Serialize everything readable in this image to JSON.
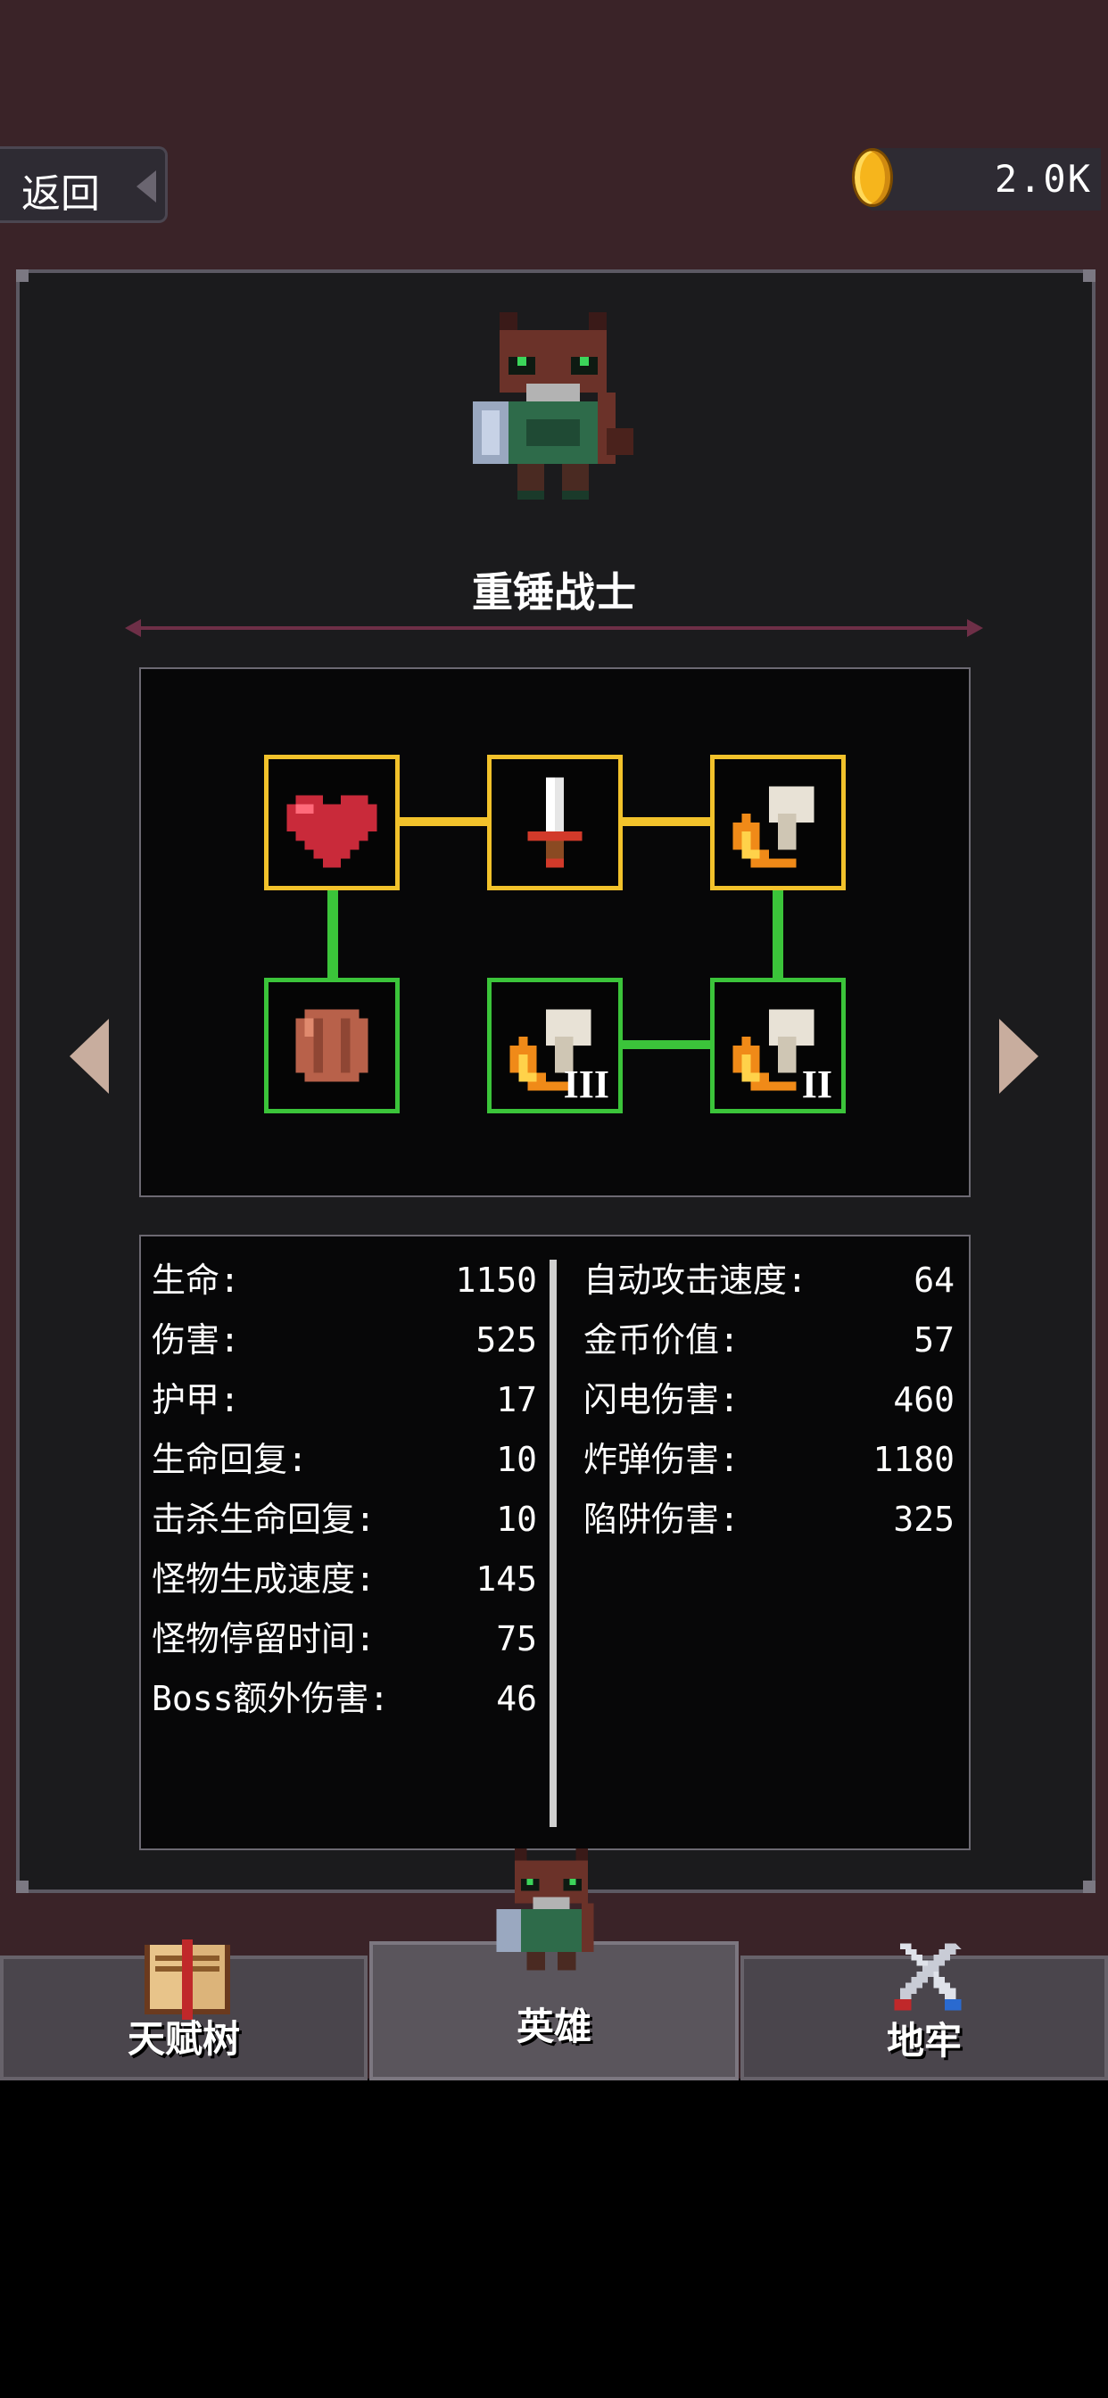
{
  "header": {
    "back_label": "返回",
    "coins": "2.0K"
  },
  "hero": {
    "name": "重锤战士"
  },
  "talent_tree": {
    "nodes": [
      {
        "icon": "heart-icon",
        "state": "gold",
        "level": ""
      },
      {
        "icon": "sword-icon",
        "state": "gold",
        "level": ""
      },
      {
        "icon": "fire-hammer-icon",
        "state": "gold",
        "level": ""
      },
      {
        "icon": "wooden-shield-icon",
        "state": "green",
        "level": ""
      },
      {
        "icon": "fire-hammer-icon",
        "state": "green",
        "level": "III"
      },
      {
        "icon": "fire-hammer-icon",
        "state": "green",
        "level": "II"
      }
    ],
    "colors": {
      "unlocked": "#f2c22b",
      "available": "#3bc43a"
    }
  },
  "stats": {
    "left": [
      {
        "label": "生命:",
        "value": "1150"
      },
      {
        "label": "伤害:",
        "value": "525"
      },
      {
        "label": "护甲:",
        "value": "17"
      },
      {
        "label": "生命回复:",
        "value": "10"
      },
      {
        "label": "击杀生命回复:",
        "value": "10"
      },
      {
        "label": "怪物生成速度:",
        "value": "145"
      },
      {
        "label": "怪物停留时间:",
        "value": "75"
      },
      {
        "label": "Boss额外伤害:",
        "value": "46"
      }
    ],
    "right": [
      {
        "label": "自动攻击速度:",
        "value": "64"
      },
      {
        "label": "金币价值:",
        "value": "57"
      },
      {
        "label": "闪电伤害:",
        "value": "460"
      },
      {
        "label": "炸弹伤害:",
        "value": "1180"
      },
      {
        "label": "陷阱伤害:",
        "value": "325"
      }
    ]
  },
  "tabs": [
    {
      "label": "天赋树",
      "icon": "book-icon",
      "active": false
    },
    {
      "label": "英雄",
      "icon": "hero-icon",
      "active": true
    },
    {
      "label": "地牢",
      "icon": "crossed-swords-icon",
      "active": false
    }
  ]
}
